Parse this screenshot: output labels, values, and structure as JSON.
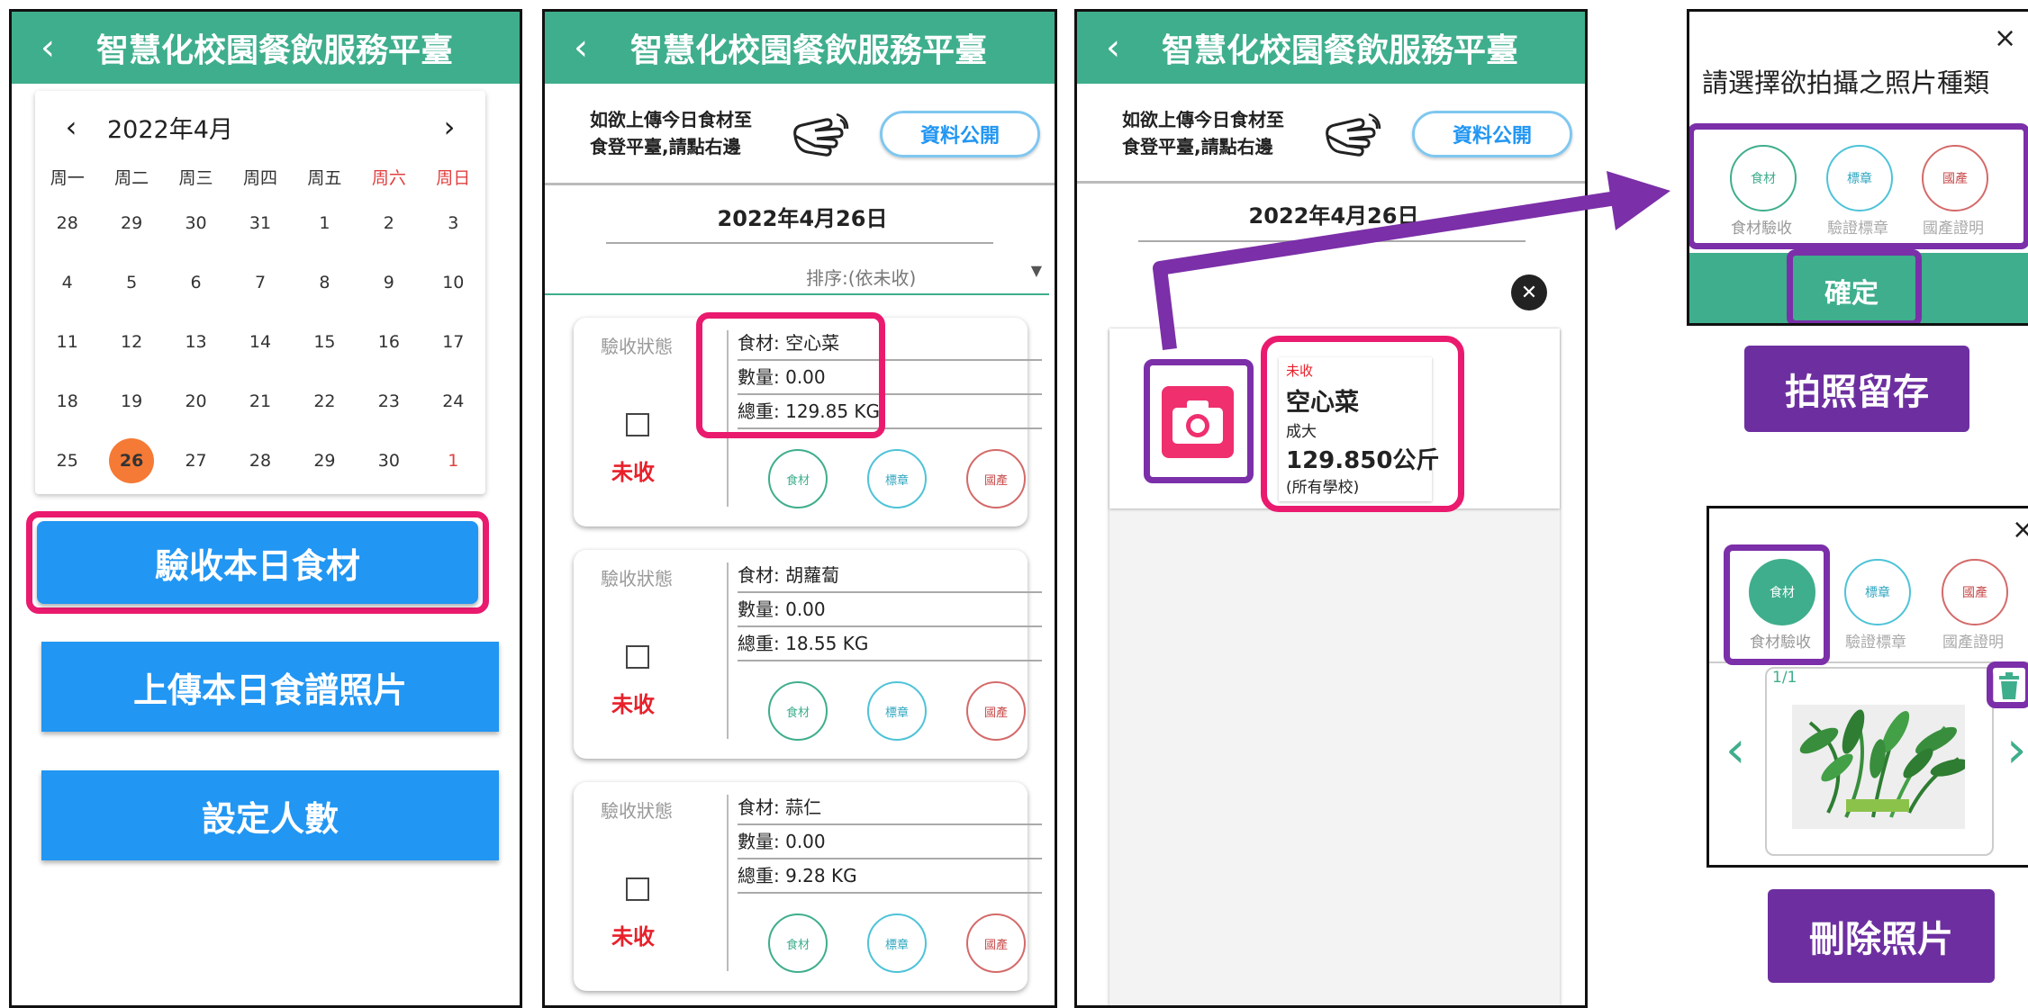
{
  "app_title": "智慧化校園餐飲服務平臺",
  "back_icon": "‹",
  "calendar": {
    "month_label": "2022年4月",
    "prev": "‹",
    "next": "›",
    "weekdays": [
      "周一",
      "周二",
      "周三",
      "周四",
      "周五",
      "周六",
      "周日"
    ],
    "weeks": [
      [
        "28",
        "29",
        "30",
        "31",
        "1",
        "2",
        "3"
      ],
      [
        "4",
        "5",
        "6",
        "7",
        "8",
        "9",
        "10"
      ],
      [
        "11",
        "12",
        "13",
        "14",
        "15",
        "16",
        "17"
      ],
      [
        "18",
        "19",
        "20",
        "21",
        "22",
        "23",
        "24"
      ],
      [
        "25",
        "26",
        "27",
        "28",
        "29",
        "30",
        "1"
      ]
    ],
    "selected_day": "26"
  },
  "main_buttons": [
    "驗收本日食材",
    "上傳本日食譜照片",
    "設定人數"
  ],
  "upload_hint": {
    "line1": "如欲上傳今日食材至",
    "line2": "食登平臺,請點右邊"
  },
  "public_button": "資料公開",
  "date_heading": "2022年4月26日",
  "sort_label": "排序:(依未收)",
  "status_label": "驗收狀態",
  "unreceived": "未收",
  "badges": {
    "food": "食材",
    "mark": "標章",
    "origin": "國產"
  },
  "items": [
    {
      "name": "食材: 空心菜",
      "qty": "數量: 0.00",
      "weight": "總重: 129.85 KG"
    },
    {
      "name": "食材: 胡蘿蔔",
      "qty": "數量: 0.00",
      "weight": "總重: 18.55 KG"
    },
    {
      "name": "食材: 蒜仁",
      "qty": "數量: 0.00",
      "weight": "總重: 9.28 KG"
    }
  ],
  "detail": {
    "status": "未收",
    "name": "空心菜",
    "supplier": "成大",
    "weight": "129.850公斤",
    "scope": "(所有學校)",
    "close_icon": "✕"
  },
  "popup": {
    "title": "請選擇欲拍攝之照片種類",
    "close": "×",
    "options": [
      "食材驗收",
      "驗證標章",
      "國產證明"
    ],
    "confirm": "確定"
  },
  "label_photo": "拍照留存",
  "viewer": {
    "close": "×",
    "counter": "1/1",
    "options": [
      "食材驗收",
      "驗證標章",
      "國產證明"
    ],
    "left": "‹",
    "right": "›"
  },
  "label_delete": "刪除照片",
  "colors": {
    "header": "#3fae8c",
    "button": "#2196f3",
    "highlight_pink": "#ea1a6e",
    "highlight_purple": "#7b2fa8"
  }
}
